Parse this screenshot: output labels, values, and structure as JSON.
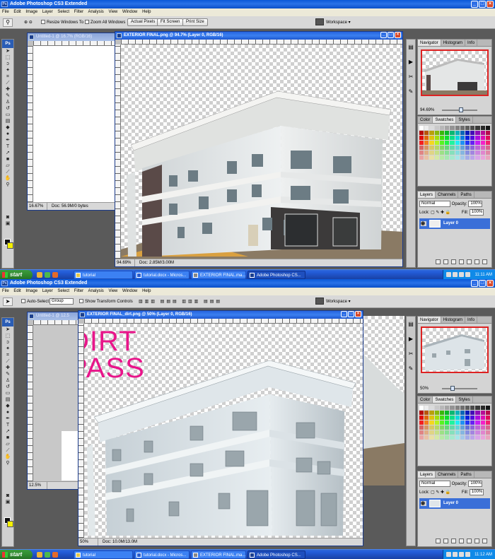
{
  "colors": {
    "titlebar_blue": "#0a58d8",
    "panel_gray": "#d4d4d4",
    "layer_selected": "#3a6fd8",
    "dirt_label": "#e8158a",
    "taskbar_blue": "#245edb",
    "start_green": "#2f8a2f"
  },
  "top": {
    "app_title": "Adobe Photoshop CS3 Extended",
    "menu": [
      "File",
      "Edit",
      "Image",
      "Layer",
      "Select",
      "Filter",
      "Analysis",
      "View",
      "Window",
      "Help"
    ],
    "options": {
      "tool_icon": "zoom-icon",
      "resize_windows": "Resize Windows To Fit",
      "zoom_all": "Zoom All Windows",
      "actual_pixels": "Actual Pixels",
      "fit_screen": "Fit Screen",
      "print_size": "Print Size",
      "workspace": "Workspace"
    },
    "doc_untitled": {
      "title": "Untitled-1 @ 16.7% (RGB/16)",
      "zoom": "16.67%",
      "doc": "Doc: 56.9M/0 bytes"
    },
    "doc_main": {
      "title": "EXTERIOR FINAL.png @ 94.7% (Layer 0, RGB/16)",
      "zoom": "94.69%",
      "doc": "Doc: 2.85M/3.00M"
    },
    "navigator": {
      "tabs": [
        "Navigator",
        "Histogram",
        "Info"
      ],
      "zoom": "94.69%"
    },
    "swatches": {
      "tabs": [
        "Color",
        "Swatches",
        "Styles"
      ]
    },
    "layers": {
      "tabs": [
        "Layers",
        "Channels",
        "Paths"
      ],
      "blend": "Normal",
      "opacity_label": "Opacity:",
      "opacity": "100%",
      "lock_label": "Lock:",
      "fill_label": "Fill:",
      "fill": "100%",
      "layer_name": "Layer 0"
    },
    "taskbar": {
      "start": "start",
      "items": [
        "tutorial",
        "tutorial.docx - Micros...",
        "EXTERIOR FINAL.ma...",
        "Adobe Photoshop CS..."
      ],
      "clock": "11:11 AM"
    }
  },
  "bottom": {
    "app_title": "Adobe Photoshop CS3 Extended",
    "menu": [
      "File",
      "Edit",
      "Image",
      "Layer",
      "Select",
      "Filter",
      "Analysis",
      "View",
      "Window",
      "Help"
    ],
    "options": {
      "tool_icon": "move-icon",
      "auto_select": "Auto-Select:",
      "group": "Group",
      "transform": "Show Transform Controls",
      "workspace": "Workspace"
    },
    "doc_untitled": {
      "title": "Untitled-1 @ 12.5",
      "zoom": "12.5%"
    },
    "doc_main": {
      "title": "EXTERIOR FINAL_dirt.png @ 50% (Layer 0, RGB/16)",
      "zoom": "50%",
      "doc": "Doc: 10.0M/13.0M"
    },
    "overlay_line1": "DIRT",
    "overlay_line2": "PASS",
    "navigator": {
      "tabs": [
        "Navigator",
        "Histogram",
        "Info"
      ],
      "zoom": "50%"
    },
    "swatches": {
      "tabs": [
        "Color",
        "Swatches",
        "Styles"
      ]
    },
    "layers": {
      "tabs": [
        "Layers",
        "Channels",
        "Paths"
      ],
      "blend": "Normal",
      "opacity_label": "Opacity:",
      "opacity": "100%",
      "lock_label": "Lock:",
      "fill_label": "Fill:",
      "fill": "100%",
      "layer_name": "Layer 0"
    },
    "taskbar": {
      "start": "start",
      "items": [
        "tutorial",
        "tutorial.docx - Micros...",
        "EXTERIOR FINAL.ma...",
        "Adobe Photoshop CS..."
      ],
      "clock": "11:12 AM"
    }
  }
}
